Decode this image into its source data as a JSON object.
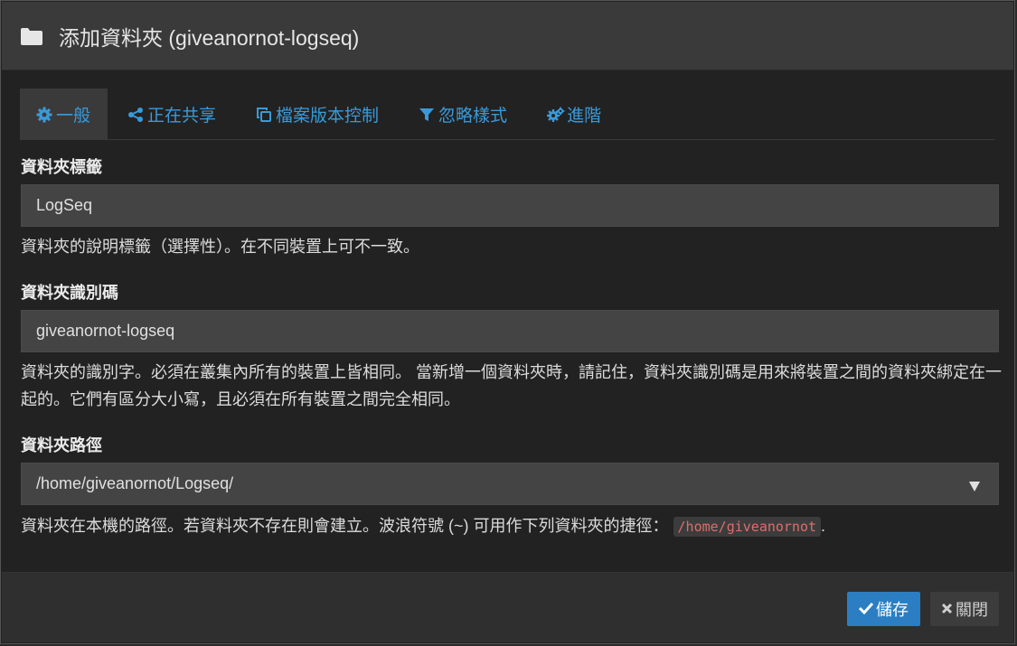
{
  "header": {
    "title": "添加資料夾 (giveanornot-logseq)",
    "icon": "folder-icon"
  },
  "tabs": [
    {
      "label": "一般",
      "icon": "gear-icon",
      "active": true
    },
    {
      "label": "正在共享",
      "icon": "share-icon",
      "active": false
    },
    {
      "label": "檔案版本控制",
      "icon": "copy-icon",
      "active": false
    },
    {
      "label": "忽略樣式",
      "icon": "filter-icon",
      "active": false
    },
    {
      "label": "進階",
      "icon": "gears-icon",
      "active": false
    }
  ],
  "fields": {
    "label": {
      "title": "資料夾標籤",
      "value": "LogSeq",
      "help": "資料夾的說明標籤（選擇性）。在不同裝置上可不一致。"
    },
    "id": {
      "title": "資料夾識別碼",
      "value": "giveanornot-logseq",
      "help": "資料夾的識別字。必須在叢集內所有的裝置上皆相同。 當新增一個資料夾時，請記住，資料夾識別碼是用來將裝置之間的資料夾綁定在一起的。它們有區分大小寫，且必須在所有裝置之間完全相同。"
    },
    "path": {
      "title": "資料夾路徑",
      "value": "/home/giveanornot/Logseq/",
      "help_prefix": "資料夾在本機的路徑。若資料夾不存在則會建立。波浪符號 (~) 可用作下列資料夾的捷徑：",
      "help_code": "/home/giveanornot",
      "help_suffix": "."
    }
  },
  "footer": {
    "save_label": "儲存",
    "close_label": "關閉"
  },
  "colors": {
    "accent": "#3a9ad9",
    "primary_button": "#2b7ec1",
    "header_bg": "#3a3a3a",
    "body_bg": "#222222"
  }
}
